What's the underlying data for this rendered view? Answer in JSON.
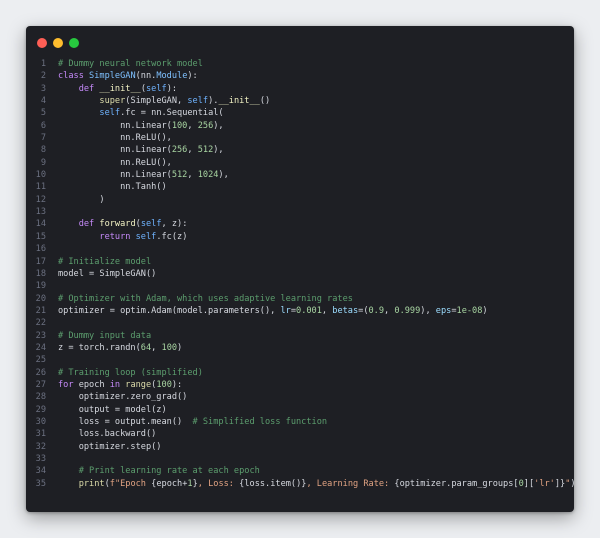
{
  "window": {
    "dots": [
      "close",
      "minimize",
      "maximize"
    ]
  },
  "colors": {
    "background": "#eceef1",
    "editor_bg": "#1e1f24",
    "comment": "#5c9e6e",
    "keyword": "#c58af9",
    "class_name": "#7fc1ff",
    "function": "#f2f2c4",
    "number": "#a8d5a2",
    "string": "#e0a282"
  },
  "code": {
    "lines": [
      {
        "n": "1",
        "tokens": [
          [
            "comment",
            "# Dummy neural network model"
          ]
        ]
      },
      {
        "n": "2",
        "tokens": [
          [
            "keyword",
            "class "
          ],
          [
            "class",
            "SimpleGAN"
          ],
          [
            "plain",
            "(nn."
          ],
          [
            "class",
            "Module"
          ],
          [
            "plain",
            "):"
          ]
        ]
      },
      {
        "n": "3",
        "tokens": [
          [
            "plain",
            "    "
          ],
          [
            "keyword",
            "def "
          ],
          [
            "func",
            "__init__"
          ],
          [
            "plain",
            "("
          ],
          [
            "self",
            "self"
          ],
          [
            "plain",
            "):"
          ]
        ]
      },
      {
        "n": "4",
        "tokens": [
          [
            "plain",
            "        "
          ],
          [
            "builtin",
            "super"
          ],
          [
            "plain",
            "(SimpleGAN, "
          ],
          [
            "self",
            "self"
          ],
          [
            "plain",
            ")."
          ],
          [
            "func",
            "__init__"
          ],
          [
            "plain",
            "()"
          ]
        ]
      },
      {
        "n": "5",
        "tokens": [
          [
            "plain",
            "        "
          ],
          [
            "self",
            "self"
          ],
          [
            "plain",
            ".fc = nn.Sequential("
          ]
        ]
      },
      {
        "n": "6",
        "tokens": [
          [
            "plain",
            "            nn.Linear("
          ],
          [
            "number",
            "100"
          ],
          [
            "plain",
            ", "
          ],
          [
            "number",
            "256"
          ],
          [
            "plain",
            "),"
          ]
        ]
      },
      {
        "n": "7",
        "tokens": [
          [
            "plain",
            "            nn.ReLU(),"
          ]
        ]
      },
      {
        "n": "8",
        "tokens": [
          [
            "plain",
            "            nn.Linear("
          ],
          [
            "number",
            "256"
          ],
          [
            "plain",
            ", "
          ],
          [
            "number",
            "512"
          ],
          [
            "plain",
            "),"
          ]
        ]
      },
      {
        "n": "9",
        "tokens": [
          [
            "plain",
            "            nn.ReLU(),"
          ]
        ]
      },
      {
        "n": "10",
        "tokens": [
          [
            "plain",
            "            nn.Linear("
          ],
          [
            "number",
            "512"
          ],
          [
            "plain",
            ", "
          ],
          [
            "number",
            "1024"
          ],
          [
            "plain",
            "),"
          ]
        ]
      },
      {
        "n": "11",
        "tokens": [
          [
            "plain",
            "            nn.Tanh()"
          ]
        ]
      },
      {
        "n": "12",
        "tokens": [
          [
            "plain",
            "        )"
          ]
        ]
      },
      {
        "n": "13",
        "tokens": []
      },
      {
        "n": "14",
        "tokens": [
          [
            "plain",
            "    "
          ],
          [
            "keyword",
            "def "
          ],
          [
            "func",
            "forward"
          ],
          [
            "plain",
            "("
          ],
          [
            "self",
            "self"
          ],
          [
            "plain",
            ", z):"
          ]
        ]
      },
      {
        "n": "15",
        "tokens": [
          [
            "plain",
            "        "
          ],
          [
            "keyword",
            "return "
          ],
          [
            "self",
            "self"
          ],
          [
            "plain",
            ".fc(z)"
          ]
        ]
      },
      {
        "n": "16",
        "tokens": []
      },
      {
        "n": "17",
        "tokens": [
          [
            "comment",
            "# Initialize model"
          ]
        ]
      },
      {
        "n": "18",
        "tokens": [
          [
            "plain",
            "model = SimpleGAN()"
          ]
        ]
      },
      {
        "n": "19",
        "tokens": []
      },
      {
        "n": "20",
        "tokens": [
          [
            "comment",
            "# Optimizer with Adam, which uses adaptive learning rates"
          ]
        ]
      },
      {
        "n": "21",
        "tokens": [
          [
            "plain",
            "optimizer = optim.Adam(model.parameters(), "
          ],
          [
            "param",
            "lr"
          ],
          [
            "plain",
            "="
          ],
          [
            "number",
            "0.001"
          ],
          [
            "plain",
            ", "
          ],
          [
            "param",
            "betas"
          ],
          [
            "plain",
            "=("
          ],
          [
            "number",
            "0.9"
          ],
          [
            "plain",
            ", "
          ],
          [
            "number",
            "0.999"
          ],
          [
            "plain",
            "), "
          ],
          [
            "param",
            "eps"
          ],
          [
            "plain",
            "="
          ],
          [
            "number",
            "1e-08"
          ],
          [
            "plain",
            ")"
          ]
        ]
      },
      {
        "n": "22",
        "tokens": []
      },
      {
        "n": "23",
        "tokens": [
          [
            "comment",
            "# Dummy input data"
          ]
        ]
      },
      {
        "n": "24",
        "tokens": [
          [
            "plain",
            "z = torch.randn("
          ],
          [
            "number",
            "64"
          ],
          [
            "plain",
            ", "
          ],
          [
            "number",
            "100"
          ],
          [
            "plain",
            ")"
          ]
        ]
      },
      {
        "n": "25",
        "tokens": []
      },
      {
        "n": "26",
        "tokens": [
          [
            "comment",
            "# Training loop (simplified)"
          ]
        ]
      },
      {
        "n": "27",
        "tokens": [
          [
            "keyword",
            "for "
          ],
          [
            "plain",
            "epoch "
          ],
          [
            "keyword",
            "in "
          ],
          [
            "builtin",
            "range"
          ],
          [
            "plain",
            "("
          ],
          [
            "number",
            "100"
          ],
          [
            "plain",
            "):"
          ]
        ]
      },
      {
        "n": "28",
        "tokens": [
          [
            "plain",
            "    optimizer.zero_grad()"
          ]
        ]
      },
      {
        "n": "29",
        "tokens": [
          [
            "plain",
            "    output = model(z)"
          ]
        ]
      },
      {
        "n": "30",
        "tokens": [
          [
            "plain",
            "    loss = output.mean()  "
          ],
          [
            "comment",
            "# Simplified loss function"
          ]
        ]
      },
      {
        "n": "31",
        "tokens": [
          [
            "plain",
            "    loss.backward()"
          ]
        ]
      },
      {
        "n": "32",
        "tokens": [
          [
            "plain",
            "    optimizer.step()"
          ]
        ]
      },
      {
        "n": "33",
        "tokens": []
      },
      {
        "n": "34",
        "tokens": [
          [
            "plain",
            "    "
          ],
          [
            "comment",
            "# Print learning rate at each epoch"
          ]
        ]
      },
      {
        "n": "35",
        "tokens": [
          [
            "plain",
            "    "
          ],
          [
            "builtin",
            "print"
          ],
          [
            "plain",
            "("
          ],
          [
            "string",
            "f\"Epoch "
          ],
          [
            "plain",
            "{epoch+"
          ],
          [
            "number",
            "1"
          ],
          [
            "plain",
            "}"
          ],
          [
            "string",
            ", Loss: "
          ],
          [
            "plain",
            "{loss.item()}"
          ],
          [
            "string",
            ", Learning Rate: "
          ],
          [
            "plain",
            "{optimizer.param_groups["
          ],
          [
            "number",
            "0"
          ],
          [
            "plain",
            "]["
          ],
          [
            "string",
            "'lr'"
          ],
          [
            "plain",
            "]}"
          ],
          [
            "string",
            "\""
          ],
          [
            "plain",
            ")"
          ]
        ]
      }
    ]
  }
}
